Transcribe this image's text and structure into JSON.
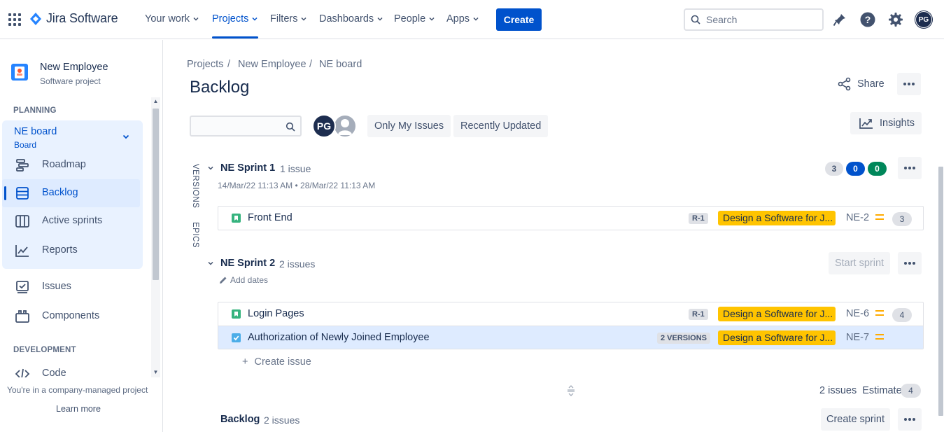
{
  "topnav": {
    "logo_text": "Jira Software",
    "items": [
      {
        "label": "Your work"
      },
      {
        "label": "Projects"
      },
      {
        "label": "Filters"
      },
      {
        "label": "Dashboards"
      },
      {
        "label": "People"
      },
      {
        "label": "Apps"
      }
    ],
    "active_item": "Projects",
    "create_label": "Create",
    "search_placeholder": "Search",
    "user_initials": "PG",
    "icons": [
      "app-switcher-icon",
      "jira-logo-icon",
      "notifications-icon",
      "help-icon",
      "settings-icon"
    ]
  },
  "sidebar": {
    "project_name": "New Employee",
    "project_type": "Software project",
    "planning_title": "PLANNING",
    "board_name": "NE board",
    "board_sub": "Board",
    "planning_items": [
      {
        "label": "Roadmap",
        "icon": "roadmap-icon"
      },
      {
        "label": "Backlog",
        "icon": "backlog-icon"
      },
      {
        "label": "Active sprints",
        "icon": "board-icon"
      },
      {
        "label": "Reports",
        "icon": "reports-icon"
      }
    ],
    "other_items": [
      {
        "label": "Issues",
        "icon": "issues-icon"
      },
      {
        "label": "Components",
        "icon": "components-icon"
      }
    ],
    "development_title": "DEVELOPMENT",
    "dev_items": [
      {
        "label": "Code",
        "icon": "code-icon"
      }
    ],
    "footer_text": "You're in a company-managed project",
    "learn_more": "Learn more"
  },
  "main": {
    "breadcrumb": [
      "Projects",
      "New Employee",
      "NE board"
    ],
    "title": "Backlog",
    "share_label": "Share",
    "quick_filters": [
      "Only My Issues",
      "Recently Updated"
    ],
    "avatar_initials": "PG",
    "insights_label": "Insights",
    "side_tabs": [
      "VERSIONS",
      "EPICS"
    ],
    "sprint1": {
      "name": "NE Sprint 1",
      "count": "1 issue",
      "dates": "14/Mar/22 11:13 AM • 28/Mar/22 11:13 AM",
      "status_counts": {
        "todo": "3",
        "in_progress": "0",
        "done": "0"
      },
      "issues": [
        {
          "summary": "Front End",
          "lozenge": "R-1",
          "epic": "Design a Software for J...",
          "key": "NE-2",
          "estimate": "3",
          "type": "story"
        }
      ]
    },
    "sprint2": {
      "name": "NE Sprint 2",
      "count": "2 issues",
      "add_dates": "Add dates",
      "start_label": "Start sprint",
      "issues": [
        {
          "summary": "Login Pages",
          "lozenge": "R-1",
          "epic": "Design a Software for J...",
          "key": "NE-6",
          "estimate": "4",
          "type": "story"
        },
        {
          "summary": "Authorization of Newly Joined Employee",
          "lozenge": "2 VERSIONS",
          "epic": "Design a Software for J...",
          "key": "NE-7",
          "estimate": "",
          "type": "task"
        }
      ],
      "create_issue": "Create issue",
      "footer_count": "2 issues",
      "footer_estimate_label": "Estimate",
      "footer_estimate": "4"
    },
    "backlog": {
      "name": "Backlog",
      "count": "2 issues",
      "create_sprint": "Create sprint"
    }
  },
  "colors": {
    "brand": "#0052cc",
    "epic": "#ffc400",
    "done": "#00875a",
    "story": "#36b37e",
    "task": "#4bade8",
    "priority_medium": "#ffab00"
  }
}
